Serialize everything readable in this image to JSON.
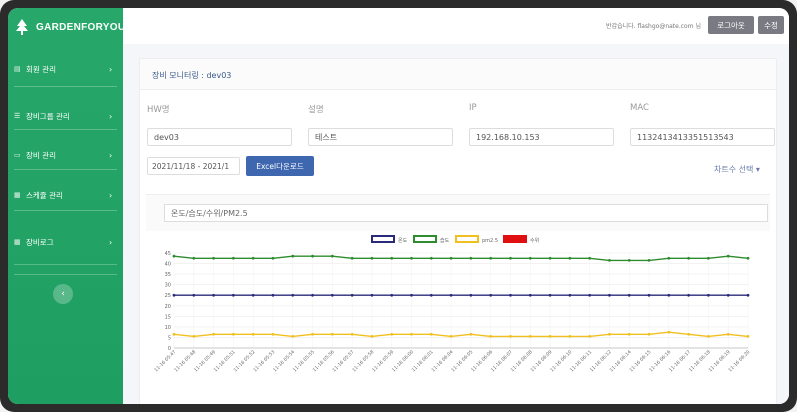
{
  "brand": {
    "name": "GARDENFORYOU",
    "logo_icon": "tree-icon"
  },
  "sidebar": {
    "items": [
      {
        "label": "회원 관리",
        "icon": "list-icon"
      },
      {
        "label": "장비그룹 관리",
        "icon": "list-icon"
      },
      {
        "label": "장비 관리",
        "icon": "monitor-icon"
      },
      {
        "label": "스케쥴 관리",
        "icon": "calendar-icon"
      },
      {
        "label": "장비로그",
        "icon": "grid-icon"
      }
    ],
    "arrow": "›",
    "collapse": "‹"
  },
  "topbar": {
    "welcome": "반갑습니다. flashgo@nate.com 님",
    "logout_label": "로그아웃",
    "edit_label": "수정"
  },
  "card": {
    "title": "장비 모니터링 : dev03"
  },
  "fields": {
    "hw_label": "HW명",
    "hw_value": "dev03",
    "desc_label": "설명",
    "desc_value": "테스트",
    "ip_label": "IP",
    "ip_value": "192.168.10.153",
    "mac_label": "MAC",
    "mac_value": "1132413413351513543"
  },
  "date_range": "2021/11/18 - 2021/1",
  "excel_label": "Excel다운로드",
  "chart_select_label": "차트수 선택 ▾",
  "chart_input": "온도/습도/수위/PM2.5",
  "colors": {
    "sidebar": "#22a366",
    "temp": "#2a2a7a",
    "humidity": "#2e8b2e",
    "pm25": "#f0c020",
    "water": "#e01010"
  },
  "chart_data": {
    "type": "line",
    "legend_position": "top-center",
    "ylim": [
      0,
      45
    ],
    "yticks": [
      0,
      5,
      10,
      15,
      20,
      25,
      30,
      35,
      40,
      45
    ],
    "x": [
      "11-16 05:47",
      "11-16 05:48",
      "11-16 05:49",
      "11-16 05:51",
      "11-16 05:52",
      "11-16 05:53",
      "11-16 05:54",
      "11-16 05:55",
      "11-16 05:56",
      "11-16 05:57",
      "11-16 05:58",
      "11-16 05:59",
      "11-16 06:00",
      "11-16 06:01",
      "11-16 06:04",
      "11-16 06:05",
      "11-16 06:06",
      "11-16 06:07",
      "11-16 06:08",
      "11-16 06:09",
      "11-16 06:10",
      "11-16 06:11",
      "11-16 06:12",
      "11-16 06:14",
      "11-16 06:15",
      "11-16 06:16",
      "11-16 06:17",
      "11-16 06:18",
      "11-16 06:19",
      "11-16 06:20"
    ],
    "series": [
      {
        "name": "온도",
        "color": "#2a2a7a",
        "values": [
          25,
          25,
          25,
          25,
          25,
          25,
          25,
          25,
          25,
          25,
          25,
          25,
          25,
          25,
          25,
          25,
          25,
          25,
          25,
          25,
          25,
          25,
          25,
          25,
          25,
          25,
          25,
          25,
          25,
          25
        ]
      },
      {
        "name": "습도",
        "color": "#2e8b2e",
        "values": [
          43.5,
          42.5,
          42.5,
          42.5,
          42.5,
          42.5,
          43.5,
          43.5,
          43.5,
          42.5,
          42.5,
          42.5,
          42.5,
          42.5,
          42.5,
          42.5,
          42.5,
          42.5,
          42.5,
          42.5,
          42.5,
          42.5,
          41.5,
          41.5,
          41.5,
          42.5,
          42.5,
          42.5,
          43.5,
          42.5
        ]
      },
      {
        "name": "pm2.5",
        "color": "#f0c020",
        "values": [
          6.5,
          5.5,
          6.5,
          6.5,
          6.5,
          6.5,
          5.5,
          6.5,
          6.5,
          6.5,
          5.5,
          6.5,
          6.5,
          6.5,
          5.5,
          6.5,
          5.5,
          5.5,
          5.5,
          5.5,
          5.5,
          5.5,
          6.5,
          6.5,
          6.5,
          7.5,
          6.5,
          5.5,
          6.5,
          5.5
        ]
      },
      {
        "name": "수위",
        "color": "#e01010",
        "values": []
      }
    ]
  }
}
